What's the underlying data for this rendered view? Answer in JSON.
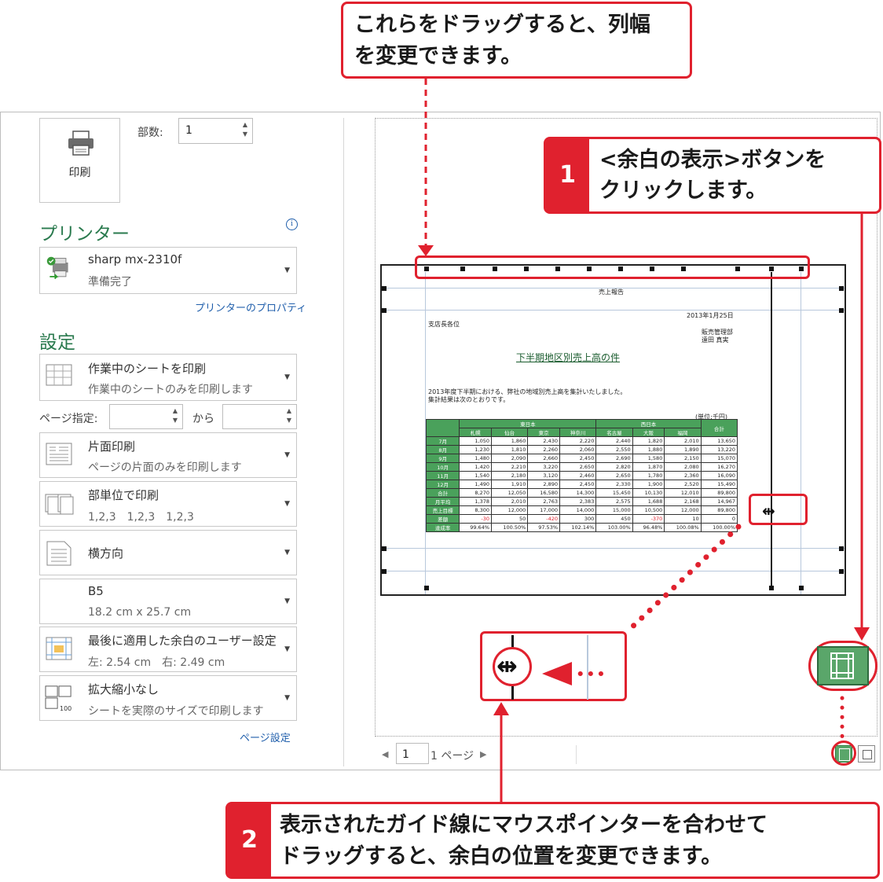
{
  "callout_top": {
    "line1": "これらをドラッグすると、列幅",
    "line2": "を変更できます。"
  },
  "callout_1": {
    "num": "1",
    "line1": "<余白の表示>ボタンを",
    "line2": "クリックします。"
  },
  "callout_2": {
    "num": "2",
    "line1": "表示されたガイド線にマウスポインターを合わせて",
    "line2": "ドラッグすると、余白の位置を変更できます。"
  },
  "print": {
    "button_label": "印刷",
    "copies_label": "部数:",
    "copies_value": "1"
  },
  "printer": {
    "section_title": "プリンター",
    "name": "sharp mx-2310f",
    "status": "準備完了",
    "properties_link": "プリンターのプロパティ"
  },
  "settings": {
    "section_title": "設定",
    "what_to_print": {
      "title": "作業中のシートを印刷",
      "desc": "作業中のシートのみを印刷します"
    },
    "pages_label": "ページ指定:",
    "pages_to": "から",
    "sides": {
      "title": "片面印刷",
      "desc": "ページの片面のみを印刷します"
    },
    "collate": {
      "title": "部単位で印刷",
      "desc": "1,2,3　1,2,3　1,2,3"
    },
    "orientation": {
      "title": "横方向"
    },
    "paper": {
      "title": "B5",
      "desc": "18.2 cm x 25.7 cm"
    },
    "margins": {
      "title": "最後に適用した余白のユーザー設定",
      "desc": "左:  2.54 cm　右:  2.49 cm"
    },
    "scaling": {
      "title": "拡大縮小なし",
      "desc": "シートを実際のサイズで印刷します",
      "icon_text": "100"
    },
    "page_setup_link": "ページ設定"
  },
  "nav": {
    "page_value": "1",
    "page_total": "1 ページ"
  },
  "sheet": {
    "header": "売上報告",
    "date": "2013年1月25日",
    "to": "支店長各位",
    "from1": "販売管理部",
    "from2": "遠田 真実",
    "title": "下半期地区別売上高の件",
    "body1": "2013年度下半期における、弊社の地域別売上高を集計いたしました。",
    "body2": "集計結果は次のとおりです。",
    "unit": "(単位:千円)",
    "group_east": "東日本",
    "group_west": "西日本",
    "total_label": "合計",
    "cols": [
      "札幌",
      "仙台",
      "東京",
      "神奈川",
      "名古屋",
      "大阪",
      "福岡"
    ],
    "rows": [
      {
        "label": "7月",
        "v": [
          "1,050",
          "1,860",
          "2,430",
          "2,220",
          "2,440",
          "1,820",
          "2,010",
          "13,650"
        ]
      },
      {
        "label": "8月",
        "v": [
          "1,230",
          "1,810",
          "2,260",
          "2,060",
          "2,550",
          "1,880",
          "1,890",
          "13,220"
        ]
      },
      {
        "label": "9月",
        "v": [
          "1,480",
          "2,090",
          "2,660",
          "2,450",
          "2,690",
          "1,580",
          "2,150",
          "15,070"
        ]
      },
      {
        "label": "10月",
        "v": [
          "1,420",
          "2,210",
          "3,220",
          "2,650",
          "2,820",
          "1,870",
          "2,080",
          "16,270"
        ]
      },
      {
        "label": "11月",
        "v": [
          "1,540",
          "2,180",
          "3,120",
          "2,460",
          "2,650",
          "1,780",
          "2,360",
          "16,090"
        ]
      },
      {
        "label": "12月",
        "v": [
          "1,490",
          "1,910",
          "2,890",
          "2,450",
          "2,330",
          "1,900",
          "2,520",
          "15,490"
        ]
      },
      {
        "label": "合計",
        "v": [
          "8,270",
          "12,050",
          "16,580",
          "14,300",
          "15,450",
          "10,130",
          "12,010",
          "89,800"
        ]
      },
      {
        "label": "月平均",
        "v": [
          "1,378",
          "2,010",
          "2,763",
          "2,383",
          "2,575",
          "1,688",
          "2,168",
          "14,967"
        ]
      },
      {
        "label": "売上目標",
        "v": [
          "8,300",
          "12,000",
          "17,000",
          "14,000",
          "15,000",
          "10,500",
          "12,000",
          "89,800"
        ]
      },
      {
        "label": "差額",
        "v": [
          "-30",
          "50",
          "-420",
          "300",
          "450",
          "-370",
          "10",
          "0"
        ]
      },
      {
        "label": "達成率",
        "v": [
          "99.64%",
          "100.50%",
          "97.53%",
          "102.14%",
          "103.00%",
          "96.48%",
          "100.08%",
          "100.00%"
        ]
      }
    ]
  },
  "colors": {
    "accent_red": "#e0212e",
    "section_green": "#2a7a4e",
    "link_blue": "#1f5eab",
    "table_green": "#4aa15b"
  },
  "icons": [
    "printer-icon",
    "info-icon",
    "sheet-grid-icon",
    "one-sided-icon",
    "collate-icon",
    "portrait-landscape-icon",
    "margins-icon",
    "scaling-icon",
    "show-margins-icon",
    "zoom-to-page-icon",
    "resize-cursor-icon"
  ]
}
